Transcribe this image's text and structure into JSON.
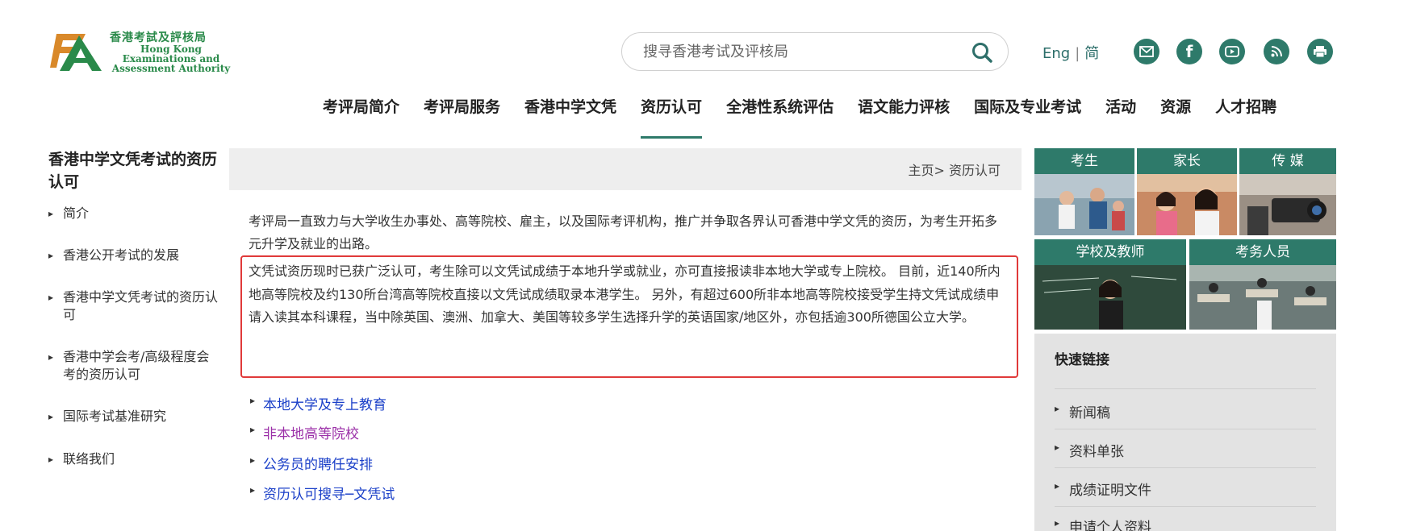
{
  "header": {
    "logo": {
      "name_cn": "香港考試及評核局",
      "name_en_lines": [
        "Hong Kong",
        "Examinations and",
        "Assessment Authority"
      ]
    },
    "search": {
      "placeholder": "搜寻香港考试及评核局"
    },
    "lang": {
      "english": "Eng",
      "separator": "|",
      "simplified": "简"
    },
    "social_icons": [
      "mail-icon",
      "facebook-icon",
      "youtube-icon",
      "rss-icon",
      "print-icon"
    ]
  },
  "nav": {
    "items": [
      "考评局简介",
      "考评局服务",
      "香港中学文凭",
      "资历认可",
      "全港性系统评估",
      "语文能力评核",
      "国际及专业考试",
      "活动",
      "资源",
      "人才招聘"
    ],
    "active": "资历认可"
  },
  "sidebar": {
    "title": "香港中学文凭考试的资历认可",
    "items": [
      {
        "label": "简介"
      },
      {
        "label": "香港公开考试的发展"
      },
      {
        "label": "香港中学文凭考试的资历认可"
      },
      {
        "label": "香港中学会考/高级程度会考的资历认可"
      },
      {
        "label": "国际考试基准研究"
      },
      {
        "label": "联络我们"
      }
    ]
  },
  "breadcrumb": {
    "text": "主页> 资历认可"
  },
  "content": {
    "intro": "考评局一直致力与大学收生办事处、高等院校、雇主，以及国际考评机构，推广并争取各界认可香港中学文凭的资历，为考生开拓多元升学及就业的出路。",
    "highlight": "文凭试资历现时已获广泛认可，考生除可以文凭试成绩于本地升学或就业，亦可直接报读非本地大学或专上院校。 目前，近140所内地高等院校及约130所台湾高等院校直接以文凭试成绩取录本港学生。 另外，有超过600所非本地高等院校接受学生持文凭试成绩申请入读其本科课程，当中除英国、澳洲、加拿大、美国等较多学生选择升学的英语国家/地区外，亦包括逾300所德国公立大学。",
    "links": [
      {
        "label": "本地大学及专上教育",
        "visited": false
      },
      {
        "label": "非本地高等院校",
        "visited": true
      },
      {
        "label": "公务员的聘任安排",
        "visited": false
      },
      {
        "label": "资历认可搜寻─文凭试",
        "visited": false
      }
    ]
  },
  "audience_tiles": [
    {
      "label": "考生"
    },
    {
      "label": "家长"
    },
    {
      "label": "传 媒"
    },
    {
      "label": "学校及教师"
    },
    {
      "label": "考务人员"
    }
  ],
  "quick_links": {
    "title": "快速链接",
    "items": [
      "新闻稿",
      "资料单张",
      "成绩证明文件",
      "申请个人资料"
    ]
  },
  "colors": {
    "brand_green": "#2e7a6a",
    "highlight_border": "#e03a3a",
    "link_blue": "#1a3fc8",
    "link_visited": "#9b2fa8"
  }
}
